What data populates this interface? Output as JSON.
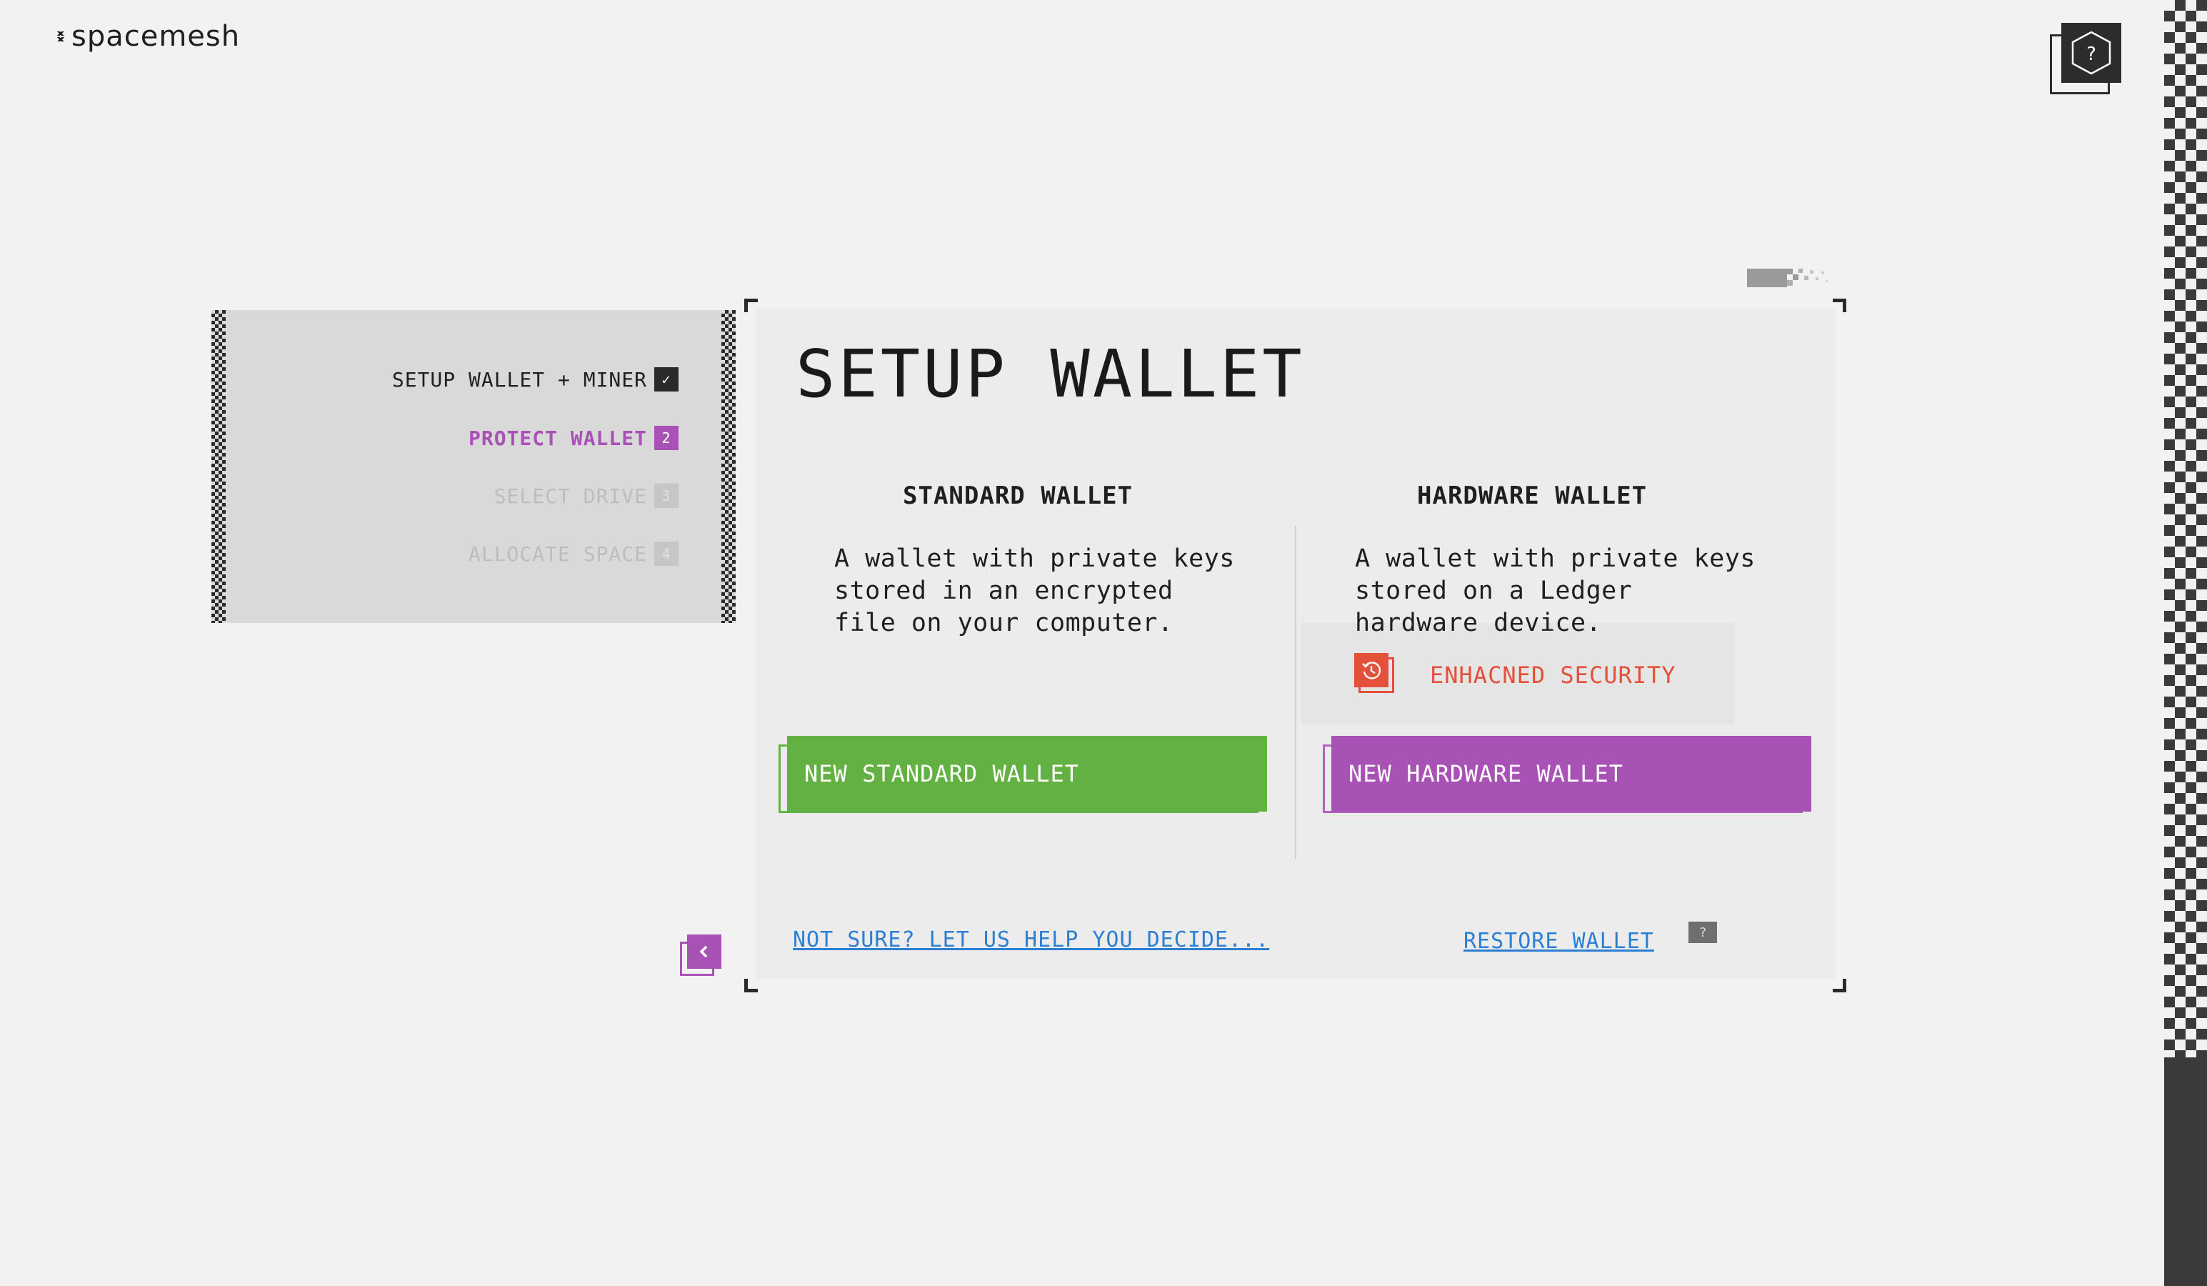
{
  "brand": {
    "name": "spacemesh"
  },
  "help": {
    "symbol": "?"
  },
  "steps": [
    {
      "label": "SETUP WALLET + MINER",
      "status": "done",
      "marker": "✓"
    },
    {
      "label": "PROTECT WALLET",
      "status": "active",
      "marker": "2"
    },
    {
      "label": "SELECT DRIVE",
      "status": "pending",
      "marker": "3"
    },
    {
      "label": "ALLOCATE SPACE",
      "status": "pending",
      "marker": "4"
    }
  ],
  "main": {
    "title": "SETUP WALLET",
    "standard": {
      "heading": "STANDARD WALLET",
      "description": "A wallet with private keys\nstored in an encrypted\nfile on your computer.",
      "button_label": "NEW STANDARD WALLET",
      "color": "#63b043"
    },
    "hardware": {
      "heading": "HARDWARE WALLET",
      "description": "A wallet with private keys\nstored on a Ledger\nhardware device.",
      "badge_label": "ENHACNED SECURITY",
      "badge_icon": "history-icon",
      "button_label": "NEW HARDWARE WALLET",
      "color": "#a952b5"
    },
    "help_link": "NOT SURE? LET US HELP YOU DECIDE...",
    "restore_link": "RESTORE WALLET",
    "restore_help": "?"
  },
  "colors": {
    "accent": "#a952b5",
    "success": "#63b043",
    "warning": "#e4503a",
    "link": "#2d7fd3"
  }
}
